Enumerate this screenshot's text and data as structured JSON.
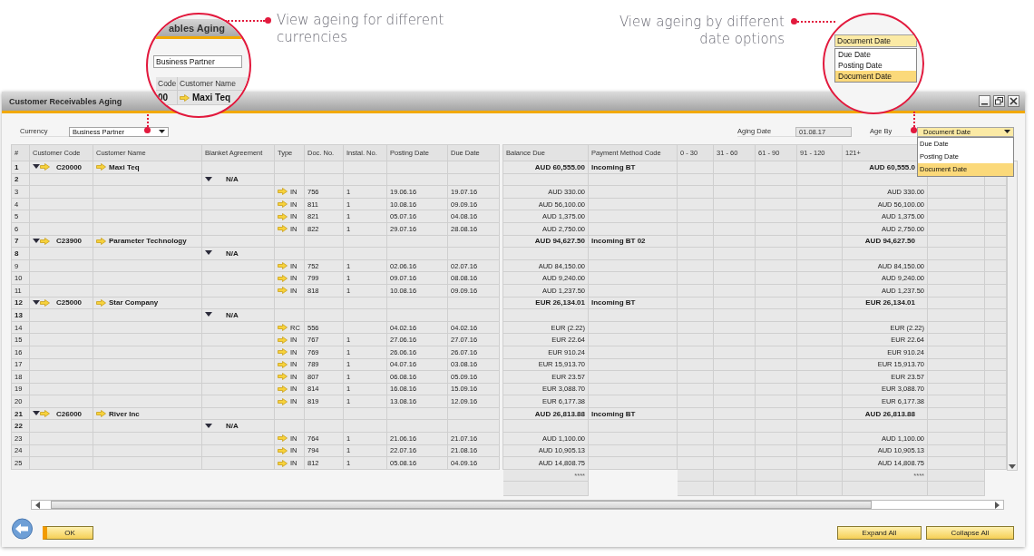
{
  "callouts": [
    {
      "text": "View ageing for different currencies"
    },
    {
      "text": "View ageing by different date options"
    }
  ],
  "magnifiers": [
    {
      "kind": "currency",
      "title": "ables Aging",
      "field": "Business Partner",
      "columns": [
        "Code",
        "Customer Name"
      ],
      "row": [
        "00",
        "Maxi Teq"
      ]
    },
    {
      "kind": "age_by",
      "field": "Document Date",
      "options": [
        {
          "label": "Due Date",
          "selected": false
        },
        {
          "label": "Posting Date",
          "selected": false
        },
        {
          "label": "Document Date",
          "selected": true
        }
      ]
    }
  ],
  "window": {
    "title": "Customer Receivables Aging"
  },
  "filters": {
    "currency": {
      "label": "Currency",
      "value": "Business Partner"
    },
    "aging_date": {
      "label": "Aging Date",
      "value": "01.08.17"
    },
    "age_by": {
      "label": "Age By",
      "value": "Document Date",
      "options": [
        {
          "label": "Due Date",
          "selected": false
        },
        {
          "label": "Posting Date",
          "selected": false
        },
        {
          "label": "Document Date",
          "selected": true
        }
      ]
    }
  },
  "table": {
    "columns": [
      "#",
      "Customer Code",
      "Customer Name",
      "Blanket Agreement",
      "Type",
      "Doc. No.",
      "Instal. No.",
      "Posting Date",
      "Due Date",
      "Balance Due",
      "Payment Method Code",
      "0 - 30",
      "31 - 60",
      "61 - 90",
      "91 - 120",
      "121+"
    ],
    "rows": [
      {
        "kind": "customer",
        "num": "1",
        "code": "C20000",
        "name": "Maxi Teq",
        "balance": "AUD 60,555.00",
        "payment": "Incoming BT",
        "aged": "AUD 60,555.0",
        "expanded": true
      },
      {
        "kind": "agreement",
        "num": "2",
        "agreement": "N/A",
        "expanded": true
      },
      {
        "kind": "document",
        "num": "3",
        "type": "IN",
        "doc_no": "756",
        "instal": "1",
        "posting": "19.06.16",
        "due": "19.07.16",
        "balance": "AUD 330.00",
        "aged": "AUD 330.00"
      },
      {
        "kind": "document",
        "num": "4",
        "type": "IN",
        "doc_no": "811",
        "instal": "1",
        "posting": "10.08.16",
        "due": "09.09.16",
        "balance": "AUD 56,100.00",
        "aged": "AUD 56,100.00"
      },
      {
        "kind": "document",
        "num": "5",
        "type": "IN",
        "doc_no": "821",
        "instal": "1",
        "posting": "05.07.16",
        "due": "04.08.16",
        "balance": "AUD 1,375.00",
        "aged": "AUD 1,375.00"
      },
      {
        "kind": "document",
        "num": "6",
        "type": "IN",
        "doc_no": "822",
        "instal": "1",
        "posting": "29.07.16",
        "due": "28.08.16",
        "balance": "AUD 2,750.00",
        "aged": "AUD 2,750.00"
      },
      {
        "kind": "customer",
        "num": "7",
        "code": "C23900",
        "name": "Parameter Technology",
        "balance": "AUD 94,627.50",
        "payment": "Incoming BT 02",
        "aged": "AUD 94,627.50",
        "expanded": true
      },
      {
        "kind": "agreement",
        "num": "8",
        "agreement": "N/A",
        "expanded": true
      },
      {
        "kind": "document",
        "num": "9",
        "type": "IN",
        "doc_no": "752",
        "instal": "1",
        "posting": "02.06.16",
        "due": "02.07.16",
        "balance": "AUD 84,150.00",
        "aged": "AUD 84,150.00"
      },
      {
        "kind": "document",
        "num": "10",
        "type": "IN",
        "doc_no": "799",
        "instal": "1",
        "posting": "09.07.16",
        "due": "08.08.16",
        "balance": "AUD 9,240.00",
        "aged": "AUD 9,240.00"
      },
      {
        "kind": "document",
        "num": "11",
        "type": "IN",
        "doc_no": "818",
        "instal": "1",
        "posting": "10.08.16",
        "due": "09.09.16",
        "balance": "AUD 1,237.50",
        "aged": "AUD 1,237.50"
      },
      {
        "kind": "customer",
        "num": "12",
        "code": "C25000",
        "name": "Star Company",
        "balance": "EUR 26,134.01",
        "payment": "Incoming BT",
        "aged": "EUR 26,134.01",
        "expanded": true
      },
      {
        "kind": "agreement",
        "num": "13",
        "agreement": "N/A",
        "expanded": true
      },
      {
        "kind": "document",
        "num": "14",
        "type": "RC",
        "doc_no": "556",
        "posting": "04.02.16",
        "due": "04.02.16",
        "balance": "EUR (2.22)",
        "aged": "EUR (2.22)"
      },
      {
        "kind": "document",
        "num": "15",
        "type": "IN",
        "doc_no": "767",
        "instal": "1",
        "posting": "27.06.16",
        "due": "27.07.16",
        "balance": "EUR 22.64",
        "aged": "EUR 22.64"
      },
      {
        "kind": "document",
        "num": "16",
        "type": "IN",
        "doc_no": "769",
        "instal": "1",
        "posting": "26.06.16",
        "due": "26.07.16",
        "balance": "EUR 910.24",
        "aged": "EUR 910.24"
      },
      {
        "kind": "document",
        "num": "17",
        "type": "IN",
        "doc_no": "789",
        "instal": "1",
        "posting": "04.07.16",
        "due": "03.08.16",
        "balance": "EUR 15,913.70",
        "aged": "EUR 15,913.70"
      },
      {
        "kind": "document",
        "num": "18",
        "type": "IN",
        "doc_no": "807",
        "instal": "1",
        "posting": "06.08.16",
        "due": "05.09.16",
        "balance": "EUR 23.57",
        "aged": "EUR 23.57"
      },
      {
        "kind": "document",
        "num": "19",
        "type": "IN",
        "doc_no": "814",
        "instal": "1",
        "posting": "16.08.16",
        "due": "15.09.16",
        "balance": "EUR 3,088.70",
        "aged": "EUR 3,088.70"
      },
      {
        "kind": "document",
        "num": "20",
        "type": "IN",
        "doc_no": "819",
        "instal": "1",
        "posting": "13.08.16",
        "due": "12.09.16",
        "balance": "EUR 6,177.38",
        "aged": "EUR 6,177.38"
      },
      {
        "kind": "customer",
        "num": "21",
        "code": "C26000",
        "name": "River Inc",
        "balance": "AUD 26,813.88",
        "payment": "Incoming BT",
        "aged": "AUD 26,813.88",
        "expanded": true
      },
      {
        "kind": "agreement",
        "num": "22",
        "agreement": "N/A",
        "expanded": true
      },
      {
        "kind": "document",
        "num": "23",
        "type": "IN",
        "doc_no": "764",
        "instal": "1",
        "posting": "21.06.16",
        "due": "21.07.16",
        "balance": "AUD 1,100.00",
        "aged": "AUD 1,100.00"
      },
      {
        "kind": "document",
        "num": "24",
        "type": "IN",
        "doc_no": "794",
        "instal": "1",
        "posting": "22.07.16",
        "due": "21.08.16",
        "balance": "AUD 10,905.13",
        "aged": "AUD 10,905.13"
      },
      {
        "kind": "document",
        "num": "25",
        "type": "IN",
        "doc_no": "812",
        "instal": "1",
        "posting": "05.08.16",
        "due": "04.09.16",
        "balance": "AUD 14,808.75",
        "aged": "AUD 14,808.75"
      }
    ],
    "totals": {
      "balance": "****",
      "aged": "****"
    }
  },
  "buttons": {
    "ok": "OK",
    "expand": "Expand All",
    "collapse": "Collapse All"
  }
}
